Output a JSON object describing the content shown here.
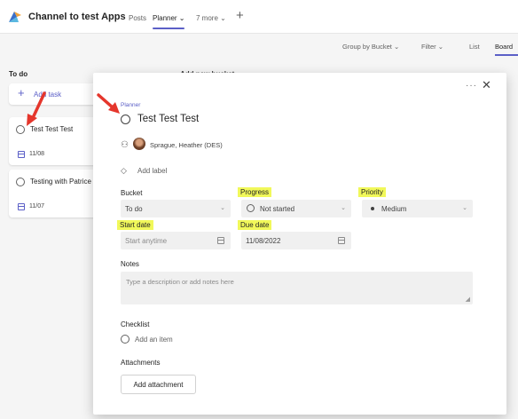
{
  "header": {
    "channel_title": "Channel to test Apps",
    "tabs": [
      {
        "label": "Posts"
      },
      {
        "label": "Planner ⌄"
      },
      {
        "label": "7 more ⌄"
      }
    ]
  },
  "toolbar": {
    "group_by": "Group by Bucket ⌄",
    "filter": "Filter ⌄",
    "list": "List",
    "board": "Board"
  },
  "board": {
    "column_title": "To do",
    "add_bucket": "Add new bucket",
    "add_task": "Add task",
    "tasks": [
      {
        "title": "Test Test Test",
        "date": "11/08"
      },
      {
        "title": "Testing with Patrice",
        "date": "11/07"
      }
    ]
  },
  "panel": {
    "breadcrumb": "Planner",
    "title": "Test Test Test",
    "assignee": "Sprague, Heather (DES)",
    "add_label": "Add label",
    "bucket": {
      "label": "Bucket",
      "value": "To do"
    },
    "progress": {
      "label": "Progress",
      "value": "Not started"
    },
    "priority": {
      "label": "Priority",
      "value": "Medium"
    },
    "start_date": {
      "label": "Start date",
      "placeholder": "Start anytime"
    },
    "due_date": {
      "label": "Due date",
      "value": "11/08/2022"
    },
    "notes": {
      "label": "Notes",
      "placeholder": "Type a description or add notes here"
    },
    "checklist": {
      "label": "Checklist",
      "add_item": "Add an item"
    },
    "attachments": {
      "label": "Attachments",
      "button": "Add attachment"
    }
  },
  "colors": {
    "accent": "#5b5fc7",
    "highlight": "#f1f85a",
    "annotation_arrow": "#e5362c"
  }
}
